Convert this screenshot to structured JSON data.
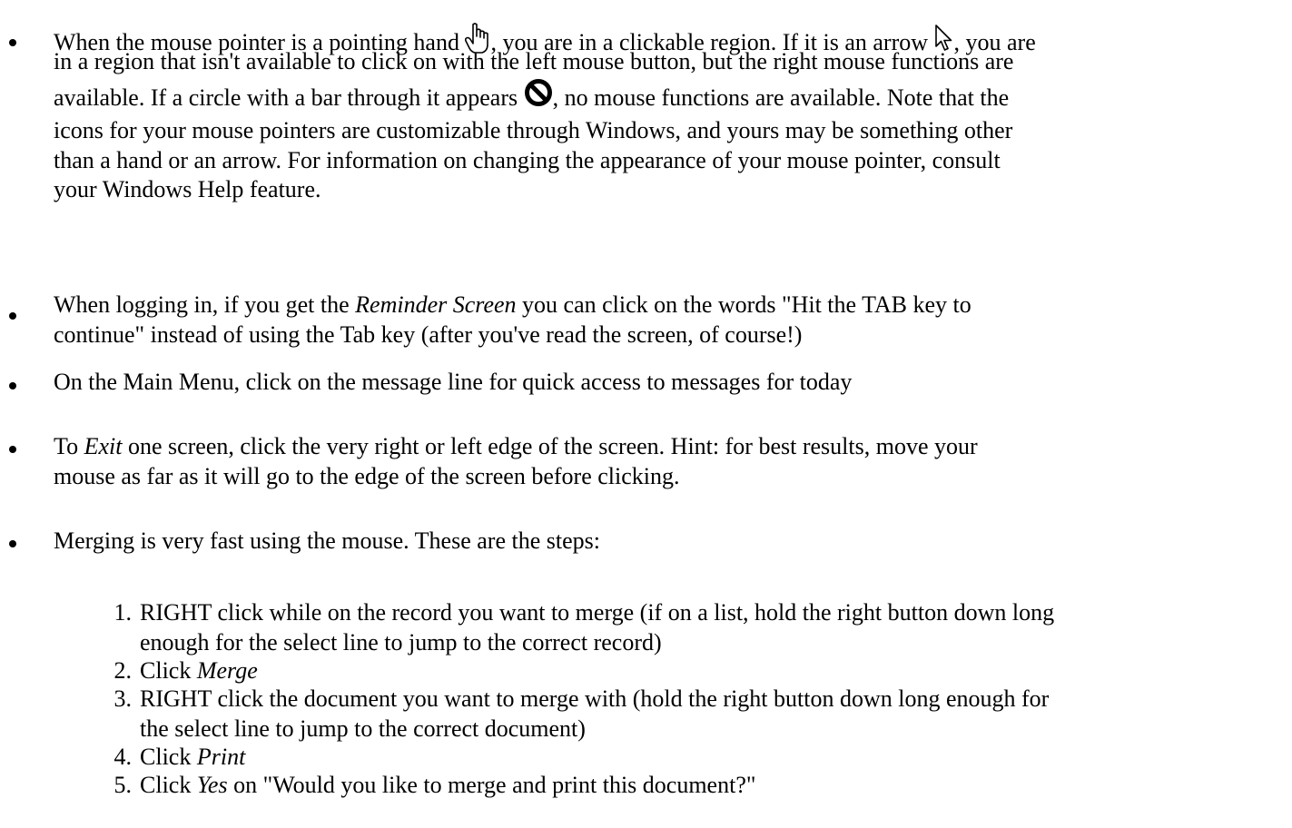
{
  "bullet1": {
    "line1_a": "When the mouse pointer is a pointing hand ",
    "line1_b": ", you are in a clickable region.  If it is an arrow ",
    "line1_c": ", you are",
    "line2": "in a region that isn't available to click on with the left mouse button, but the right mouse functions are",
    "line3_a": "available.  If a circle with a bar through it appears ",
    "line3_b": ", no mouse functions are available.  Note that the",
    "line4": "icons for your mouse pointers are customizable through Windows, and yours may be something other",
    "line5": "than a hand or an arrow.  For information on changing the appearance of your mouse pointer, consult",
    "line6": "your Windows Help feature.",
    "icons": [
      "pointing-hand-icon",
      "arrow-pointer-icon",
      "no-symbol-icon"
    ]
  },
  "bullet2": {
    "line1_a": "When logging in, if you get the ",
    "line1_em": "Reminder Screen",
    "line1_b": " you can click on the words \"Hit the TAB key to",
    "line2": "continue\" instead of using the Tab key (after you've read the screen, of course!)"
  },
  "bullet3": {
    "line1": "On the Main Menu, click on the message line for quick access to messages for today"
  },
  "bullet4": {
    "line1_a": "To ",
    "line1_em": "Exit",
    "line1_b": " one screen, click the very right or left edge of the screen.  Hint:  for best results, move your",
    "line2": "mouse as far as it will go to the edge of the screen before clicking."
  },
  "bullet5": {
    "line1": "Merging is very fast using the mouse.  These are the steps:",
    "steps": [
      {
        "num": "1.",
        "line1": "RIGHT click while on the record you want to merge (if on a list, hold the right button down long",
        "line2": "enough for the select line to jump to the correct record)"
      },
      {
        "num": "2.",
        "line1_a": "Click ",
        "line1_em": "Merge"
      },
      {
        "num": "3.",
        "line1": "RIGHT click the document you want to merge with (hold the right button down long enough for",
        "line2": "the select line to jump to the correct document)"
      },
      {
        "num": "4.",
        "line1_a": "Click ",
        "line1_em": "Print"
      },
      {
        "num": "5.",
        "line1_a": "Click ",
        "line1_em": "Yes",
        "line1_b": " on \"Would you like to merge and print this document?\""
      }
    ]
  }
}
